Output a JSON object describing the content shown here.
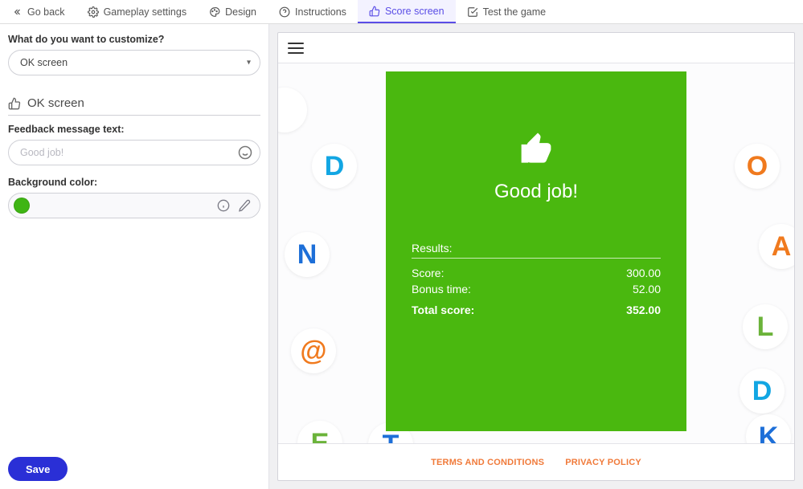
{
  "tabs": {
    "go_back": "Go back",
    "gameplay": "Gameplay settings",
    "design": "Design",
    "instructions": "Instructions",
    "score": "Score screen",
    "test": "Test the game"
  },
  "left": {
    "customize_label": "What do you want to customize?",
    "customize_value": "OK screen",
    "section_title": "OK screen",
    "feedback_label": "Feedback message text:",
    "feedback_placeholder": "Good job!",
    "bg_label": "Background color:",
    "bg_color": "#3fb514",
    "save": "Save"
  },
  "preview": {
    "message": "Good job!",
    "results_label": "Results:",
    "rows": {
      "score_label": "Score:",
      "score_value": "300.00",
      "bonus_label": "Bonus time:",
      "bonus_value": "52.00",
      "total_label": "Total score:",
      "total_value": "352.00"
    },
    "footer": {
      "terms": "TERMS AND CONDITIONS",
      "privacy": "PRIVACY POLICY"
    }
  }
}
